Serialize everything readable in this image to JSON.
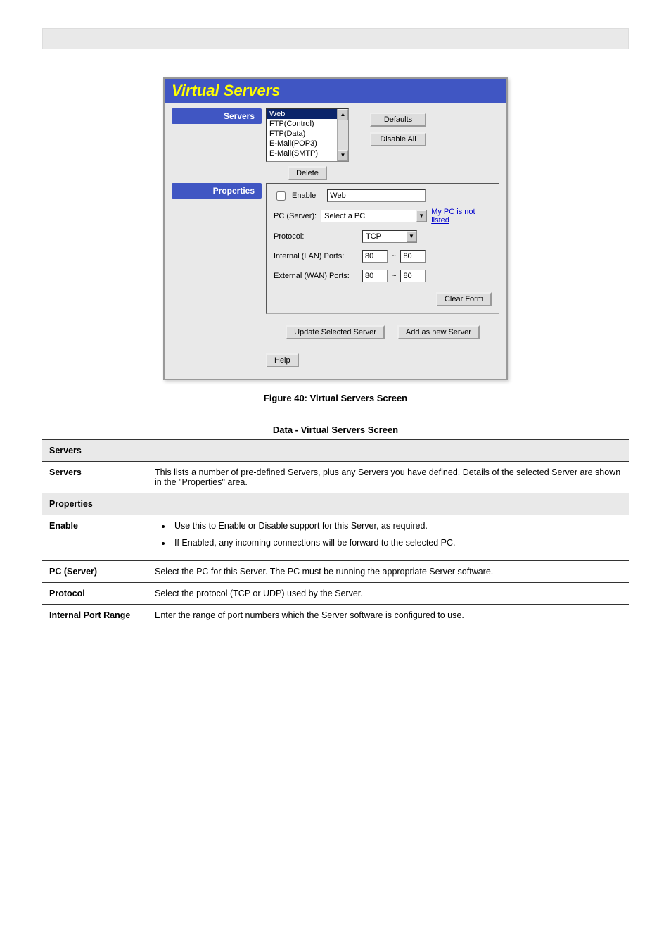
{
  "top_banner": " ",
  "panel": {
    "title": "Virtual Servers",
    "servers": {
      "label": "Servers",
      "list": {
        "items": [
          "Web",
          "FTP(Control)",
          "FTP(Data)",
          "E-Mail(POP3)",
          "E-Mail(SMTP)"
        ],
        "selected_index": 0
      },
      "delete_btn": "Delete",
      "defaults_btn": "Defaults",
      "disable_all_btn": "Disable All"
    },
    "properties": {
      "label": "Properties",
      "enable_label": "Enable",
      "enable_checked": false,
      "name_value": "Web",
      "pc_server_label": "PC (Server):",
      "pc_server_value": "Select a PC",
      "pc_not_listed_link": "My PC is not listed",
      "protocol_label": "Protocol:",
      "protocol_value": "TCP",
      "lan_ports_label": "Internal (LAN) Ports:",
      "lan_port_from": "80",
      "lan_port_to": "80",
      "wan_ports_label": "External (WAN) Ports:",
      "wan_port_from": "80",
      "wan_port_to": "80",
      "tilde": "~",
      "clear_form_btn": "Clear Form",
      "update_btn": "Update Selected Server",
      "add_btn": "Add as new Server",
      "help_btn": "Help"
    }
  },
  "fig_caption": "Figure 40: Virtual Servers Screen",
  "table_caption": "Data - Virtual Servers Screen",
  "table": {
    "servers_section": {
      "heading": "Servers",
      "row_label": "Servers",
      "row_desc": "This lists a number of pre-defined Servers, plus any Servers you have defined. Details of the selected Server are shown in the \"Properties\" area."
    },
    "properties_section": {
      "heading": "Properties",
      "rows": [
        {
          "label": "Enable",
          "bullets": [
            "Use this to Enable or Disable support for this Server, as required.",
            "If Enabled, any incoming connections will be forward to the selected PC."
          ]
        },
        {
          "label": "PC (Server)",
          "desc": "Select the PC for this Server. The PC must be running the appropriate Server software."
        },
        {
          "label": "Protocol",
          "desc": "Select the protocol (TCP or UDP) used by the Server."
        },
        {
          "label": "Internal Port Range",
          "desc": "Enter the range of port numbers which the Server software is configured to use."
        }
      ]
    }
  },
  "page_footer": " "
}
